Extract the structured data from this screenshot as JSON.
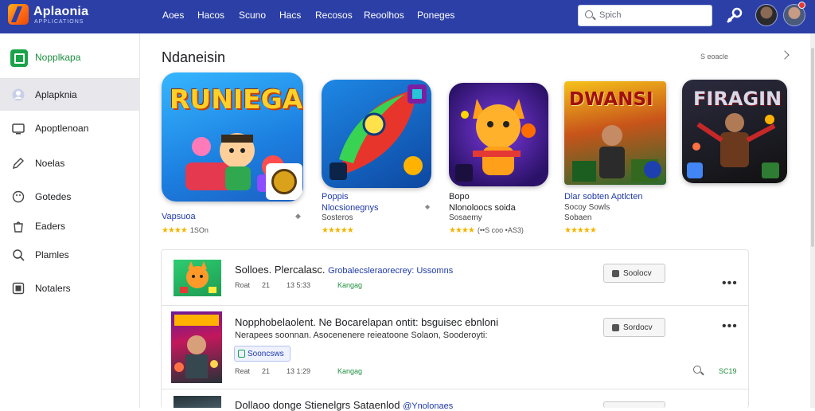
{
  "header": {
    "brand": "Aplaonia",
    "brand_sub": "APPLICATIONS",
    "nav": [
      "Aoes",
      "Hacos",
      "Scuno",
      "Hacs",
      "Recosos",
      "Reoolhos",
      "Poneges"
    ],
    "search_placeholder": "Spich",
    "icons": [
      "wrench-icon",
      "user-avatar",
      "user-avatar-2"
    ]
  },
  "sidebar": {
    "items": [
      {
        "label": "Nopplkapa",
        "icon": "app-store-icon"
      },
      {
        "label": "Aplapknia",
        "icon": "user-icon"
      },
      {
        "label": "Apoptlenoan",
        "icon": "tv-icon"
      },
      {
        "label": "Noelas",
        "icon": "pen-icon"
      },
      {
        "label": "Gotedes",
        "icon": "palette-icon"
      },
      {
        "label": "Eaders",
        "icon": "bag-icon"
      },
      {
        "label": "Plamles",
        "icon": "search-icon"
      },
      {
        "label": "Notalers",
        "icon": "grid-icon"
      }
    ]
  },
  "featured": {
    "title": "Ndaneisin",
    "see_more": "S eoacle",
    "cards": [
      {
        "tile_text": "RUNIEGAI",
        "name": "Vapsuoa",
        "sub": "",
        "rating": "★★★★",
        "rating_text": "1SOn",
        "tile_colors": [
          "#25a4f5",
          "#ffb12b"
        ]
      },
      {
        "tile_text": "",
        "name": "Poppis",
        "sub": "Nlocsionegnys",
        "sub2": "Sosteros",
        "rating": "★★★★★",
        "rating_text": "",
        "tile_colors": [
          "#1565c0",
          "#ef3b2c"
        ]
      },
      {
        "tile_text": "",
        "name": "Bopo",
        "sub": "Nlonoloocs soida",
        "sub2": "Sosaemy",
        "rating": "★★★★",
        "rating_text": "(••S coo •AS3)",
        "tile_colors": [
          "#4a1fa0",
          "#ff9f1a"
        ]
      },
      {
        "tile_text": "DWANSI",
        "name": "Dlar sobten Aptlcten",
        "sub": "Socoy Sowls",
        "sub2": "Sobaen",
        "rating": "★★★★★",
        "rating_text": "",
        "tile_colors": [
          "#2a6b2f",
          "#f6c21a"
        ]
      },
      {
        "tile_text": "FIRAGIN",
        "name": "",
        "sub": "",
        "sub2": "",
        "rating": "",
        "rating_text": "",
        "tile_colors": [
          "#1b1b2b",
          "#c62828"
        ]
      }
    ]
  },
  "list": {
    "rows": [
      {
        "title": "Solloes. Plercalasc.",
        "link": "Grobalecsleraorecrey: Ussomns",
        "desc": "",
        "meta1": "Roat",
        "meta2": "21",
        "meta3": "13 5:33",
        "meta_green": "Kangag",
        "button": "Soolocv",
        "more": "•••"
      },
      {
        "title": "Nopphobelaolent. Ne Bocarelapan ontit: bsguisec ebnloni",
        "link": "",
        "desc": "Nerapees soonnan. Asocenenere reieatoone Solaon, Sooderoyti:",
        "tag": "Sooncsws",
        "meta1": "Reat",
        "meta2": "21",
        "meta3": "13 1:29",
        "meta_green": "Kangag",
        "button": "Sordocv",
        "more": "•••",
        "right_value": "SC19"
      },
      {
        "title": "Dollaoo donge Stienelgrs Sataenlod",
        "link": "@Ynolonaes",
        "desc": "",
        "meta1": "",
        "button": "",
        "more": ""
      }
    ]
  },
  "colors": {
    "topbar": "#2b3fa6",
    "accent_green": "#1e8e3e",
    "link": "#1f3aa8",
    "star": "#f4b400"
  }
}
